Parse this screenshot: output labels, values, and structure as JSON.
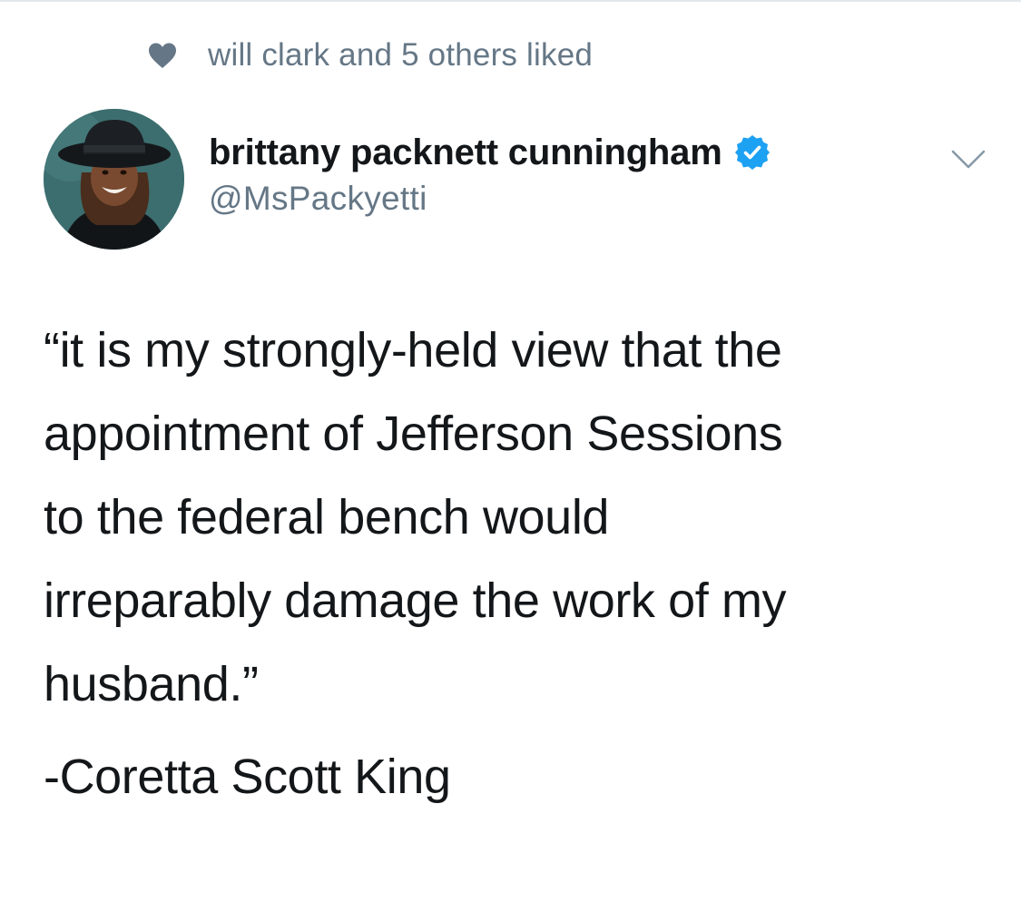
{
  "social_context": {
    "icon": "heart-icon",
    "text": "will clark and 5 others liked"
  },
  "author": {
    "display_name": "brittany packnett cunningham",
    "verified": true,
    "verified_icon": "verified-badge-icon",
    "handle": "@MsPackyetti",
    "avatar": "avatar"
  },
  "menu": {
    "icon": "chevron-down-icon"
  },
  "tweet": {
    "lines": [
      "“it is my strongly-held view that the",
      "appointment of Jefferson Sessions",
      "to the federal bench would",
      "irreparably damage the work of my",
      "husband.”"
    ],
    "attribution": "-Coretta Scott King"
  },
  "colors": {
    "primary_text": "#14171a",
    "secondary_text": "#657786",
    "verified_blue": "#1da1f2",
    "divider": "#e1e8ed"
  }
}
